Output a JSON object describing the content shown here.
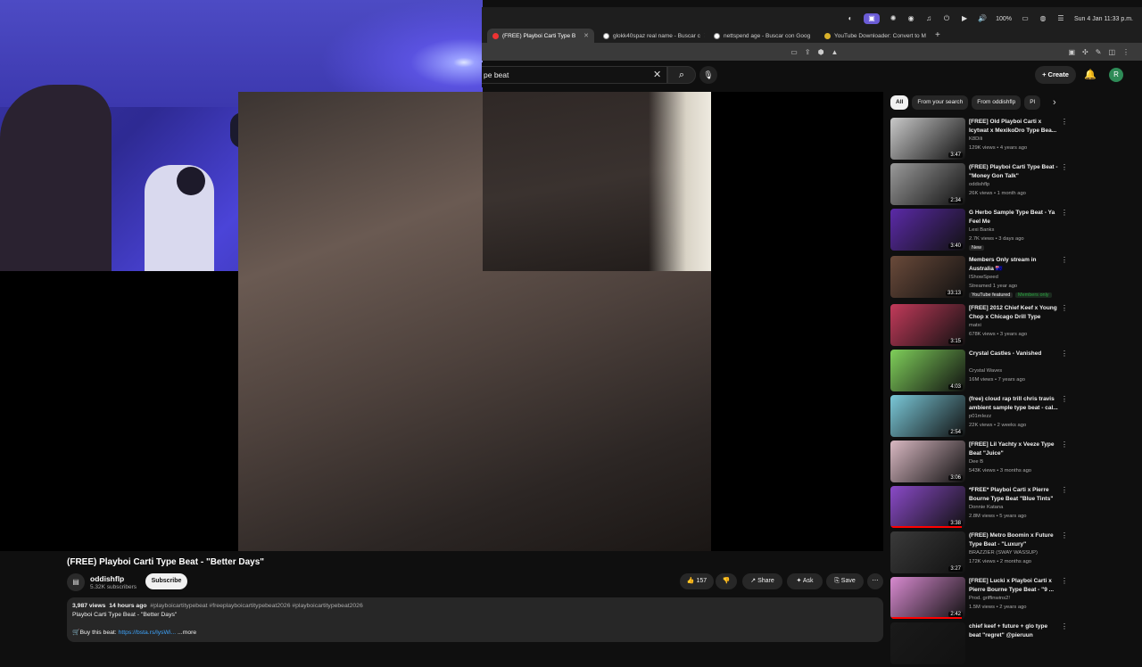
{
  "menubar": {
    "battery": "100%",
    "datetime": "Sun 4 Jan  11:33 p.m."
  },
  "tabs": [
    {
      "label": "(FREE) Playboi Carti Type B",
      "active": true
    },
    {
      "label": "glokk40spaz real name - Buscar c",
      "active": false
    },
    {
      "label": "nettspend age - Buscar con Goog",
      "active": false
    },
    {
      "label": "YouTube Downloader: Convert to M",
      "active": false
    }
  ],
  "search": {
    "value": "pe beat"
  },
  "header": {
    "create_label": "Create",
    "avatar_letter": "R"
  },
  "video": {
    "title": "(FREE) Playboi Carti Type Beat - \"Better Days\"",
    "channel": "oddishflp",
    "subscribers": "5.32K subscribers",
    "subscribe_label": "Subscribe",
    "likes": "157",
    "share_label": "Share",
    "ask_label": "Ask",
    "save_label": "Save"
  },
  "description": {
    "views": "3,987 views",
    "age": "14 hours ago",
    "tags": "#playboicartitypebeat #freeplayboicartitypebeat2026 #playboicartitypebeat2026",
    "line1": "Playboi Carti Type Beat - \"Better Days\"",
    "buy_label": "Buy this beat:",
    "buy_link": "https://bsta.rs/lysWi...",
    "more": "...more"
  },
  "chips": [
    "All",
    "From your search",
    "From oddishflp",
    "Pl"
  ],
  "recommendations": [
    {
      "title": "[FREE] Old Playboi Carti x Icytwat x MexikoDro Type Bea...",
      "channel": "K8Dili",
      "meta": "129K views • 4 years ago",
      "duration": "3:47",
      "color": "#c9c9c9"
    },
    {
      "title": "(FREE) Playboi Carti Type Beat - \"Money Gon Talk\"",
      "channel": "oddishflp",
      "meta": "26K views • 1 month ago",
      "duration": "2:34",
      "color": "#9a9a9a"
    },
    {
      "title": "G Herbo Sample Type Beat - Ya Feel Me",
      "channel": "Lexi Banks",
      "meta": "2.7K views • 3 days ago",
      "duration": "3:40",
      "badge": "New",
      "color": "#5b2aa8"
    },
    {
      "title": "Members Only stream in Australia 🇦🇺",
      "channel": "IShowSpeed",
      "meta": "Streamed 1 year ago",
      "duration": "33:13",
      "badge": "YouTube featured",
      "badge2": "Members only",
      "color": "#6a4a3a"
    },
    {
      "title": "[FREE] 2012 Chief Keef x Young Chop x Chicago Drill Type Beat...",
      "channel": "matxi",
      "meta": "678K views • 3 years ago",
      "duration": "3:15",
      "color": "#c23a5a"
    },
    {
      "title": "Crystal Castles - Vanished",
      "channel": "Crystal Waves",
      "meta": "16M views • 7 years ago",
      "duration": "4:03",
      "color": "#7fcf5a"
    },
    {
      "title": "(free) cloud rap trill chris travis ambient sample type beat - cal...",
      "channel": "p01mIezz",
      "meta": "22K views • 2 weeks ago",
      "duration": "2:54",
      "color": "#7ac8d8"
    },
    {
      "title": "[FREE] Lil Yachty x Veeze Type Beat \"Juice\"",
      "channel": "Dee B",
      "meta": "543K views • 3 months ago",
      "duration": "3:06",
      "color": "#d9b8c2"
    },
    {
      "title": "*FREE* Playboi Carti x Pierre Bourne Type Beat \"Blue Tints\"",
      "channel": "Donnie Katana",
      "meta": "2.8M views • 5 years ago",
      "duration": "3:38",
      "progress": 0.95,
      "color": "#8a4ac8"
    },
    {
      "title": "(FREE) Metro Boomin x Future Type Beat - \"Luxury\"",
      "channel": "BRAZZIER (SWAY WASSUP)",
      "meta": "172K views • 2 months ago",
      "duration": "3:27",
      "color": "#3a3a3a"
    },
    {
      "title": "[FREE] Lucki x Playboi Carti x Pierre Bourne Type Beat - \"9 ...",
      "channel": "Prod. griffinwins2!",
      "meta": "1.5M views • 2 years ago",
      "duration": "2:42",
      "progress": 0.95,
      "color": "#d88ad0"
    },
    {
      "title": "chief keef + future + glo type beat \"regret\" @pieruun",
      "channel": "",
      "meta": "",
      "duration": "",
      "color": "#1a1a1a"
    }
  ]
}
